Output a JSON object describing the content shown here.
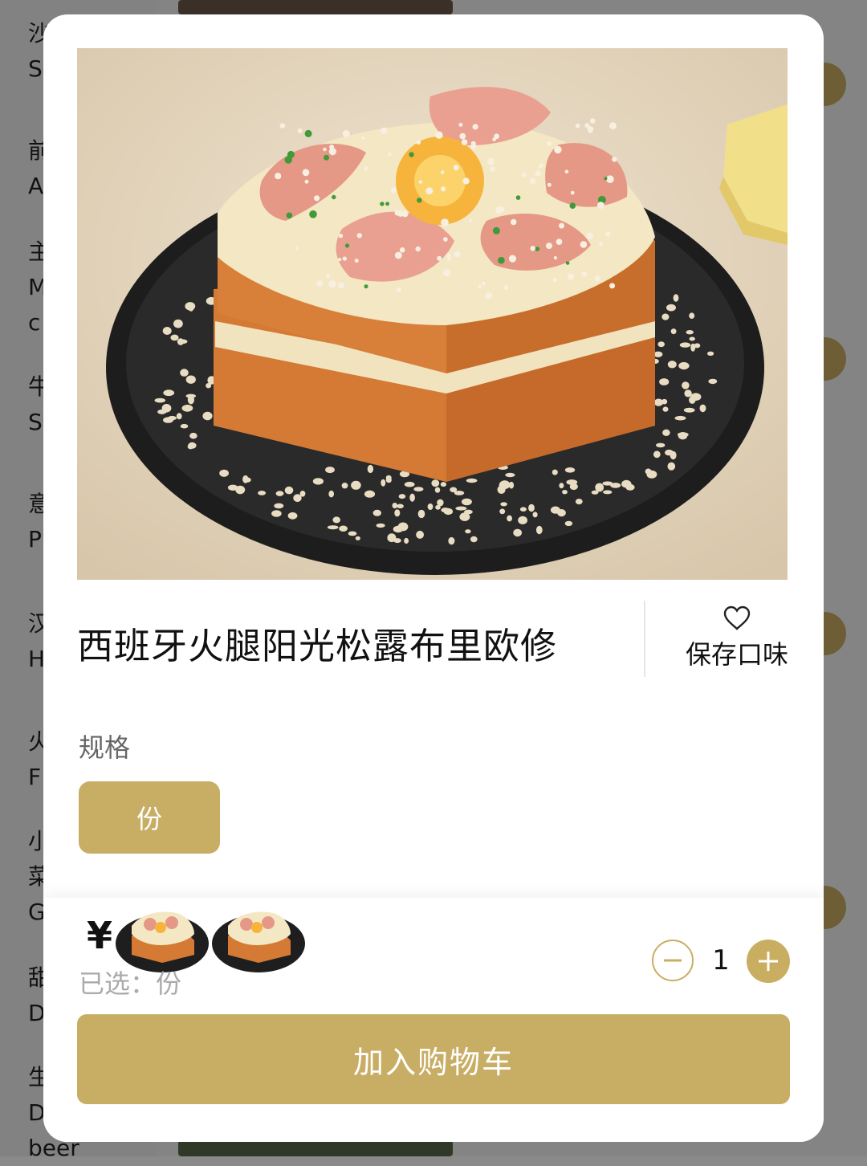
{
  "background": {
    "categories": [
      {
        "cn": "沙",
        "en": "S"
      },
      {
        "cn": "前",
        "en": "A"
      },
      {
        "cn": "主",
        "en": "M\nc"
      },
      {
        "cn": "牛",
        "en": "S"
      },
      {
        "cn": "意",
        "en": "P"
      },
      {
        "cn": "汉",
        "en": "H"
      },
      {
        "cn": "火",
        "en": "F"
      },
      {
        "cn": "小\n菜",
        "en": "G"
      },
      {
        "cn": "甜",
        "en": "D"
      },
      {
        "cn": "生",
        "en": "D\nbeer"
      }
    ]
  },
  "product": {
    "name": "西班牙火腿阳光松露布里欧修",
    "favorite_label": "保存口味",
    "image_icon": "dish-photo"
  },
  "spec": {
    "label": "规格",
    "options": [
      "份"
    ]
  },
  "order": {
    "currency": "¥",
    "selected_text": "已选：份",
    "quantity": "1"
  },
  "actions": {
    "add_to_cart": "加入购物车"
  },
  "colors": {
    "accent": "#c8ad65",
    "modal_bg": "#ffffff",
    "overlay": "rgba(0,0,0,0.46)"
  }
}
